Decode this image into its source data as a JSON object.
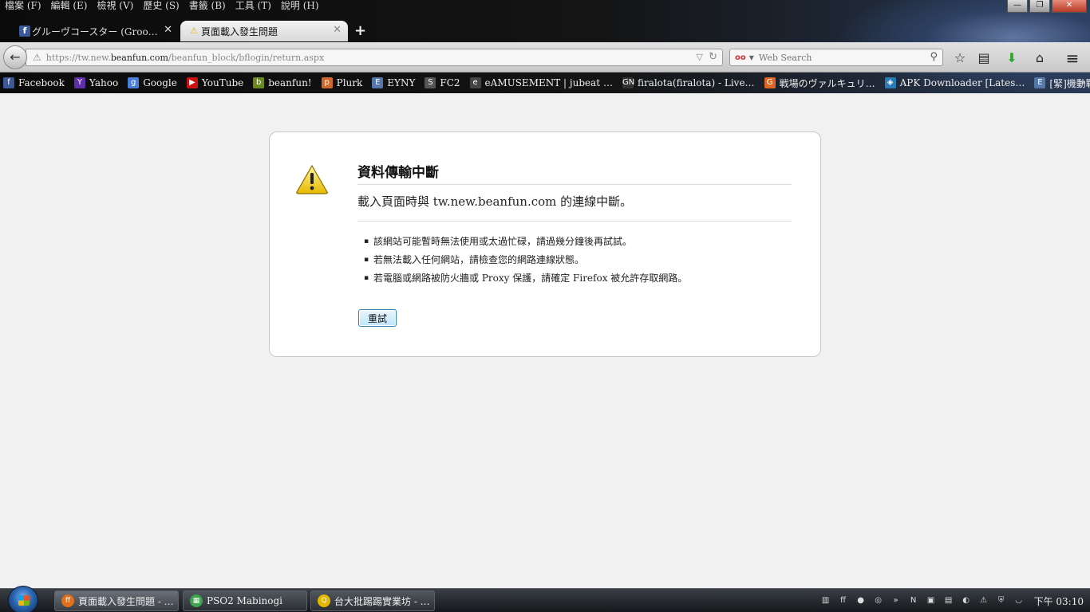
{
  "menu": [
    "檔案 (F)",
    "編輯 (E)",
    "檢視 (V)",
    "歷史 (S)",
    "書籤 (B)",
    "工具 (T)",
    "說明 (H)"
  ],
  "window_buttons": {
    "minimize": "—",
    "restore": "❐",
    "close": "✕"
  },
  "tabs": [
    {
      "label": "グルーヴコースター (Groo…",
      "icon": "f",
      "state": "inactive"
    },
    {
      "label": "頁面載入發生問題",
      "icon": "⚠",
      "state": "active"
    }
  ],
  "new_tab_label": "+",
  "navbar": {
    "back_glyph": "←",
    "url_prefix": "https://tw.new.",
    "url_domain": "beanfun.com",
    "url_path": "/beanfun_block/bflogin/return.aspx",
    "search_placeholder": "Web Search",
    "search_engine_label": "oo"
  },
  "toolbar_icons": {
    "star": "☆",
    "reading_list": "▤",
    "download": "⬇",
    "home": "⌂",
    "menu": "≡"
  },
  "bookmarks": [
    {
      "label": "Facebook",
      "icon": "f",
      "color": "#3b5998"
    },
    {
      "label": "Yahoo",
      "icon": "Y",
      "color": "#5f2ea8"
    },
    {
      "label": "Google",
      "icon": "g",
      "color": "#4a7fd8"
    },
    {
      "label": "YouTube",
      "icon": "▶",
      "color": "#cc1111"
    },
    {
      "label": "beanfun!",
      "icon": "b",
      "color": "#6a8a1e"
    },
    {
      "label": "Plurk",
      "icon": "p",
      "color": "#cf682f"
    },
    {
      "label": "EYNY",
      "icon": "E",
      "color": "#5577aa"
    },
    {
      "label": "FC2",
      "icon": "S",
      "color": "#555555"
    },
    {
      "label": "eAMUSEMENT | jubeat …",
      "icon": "e",
      "color": "#444444"
    },
    {
      "label": "firalota(firalota) - Live…",
      "icon": "GN",
      "color": "#333333"
    },
    {
      "label": "戦場のヴァルキュリ…",
      "icon": "G",
      "color": "#dd6622"
    },
    {
      "label": "APK Downloader [Lates…",
      "icon": "◈",
      "color": "#2a7ab8"
    },
    {
      "label": "[緊]機動戰士高達UC…",
      "icon": "E",
      "color": "#5577aa"
    }
  ],
  "bookmarks_more": "»",
  "error": {
    "title": "資料傳輸中斷",
    "short_desc": "載入頁面時與 tw.new.beanfun.com 的連線中斷。",
    "bullets": [
      "該網站可能暫時無法使用或太過忙碌，請過幾分鐘後再試試。",
      "若無法載入任何網站，請檢查您的網路連線狀態。",
      "若電腦或網路被防火牆或 Proxy 保護，請確定 Firefox 被允許存取網路。"
    ],
    "retry_label": "重試"
  },
  "taskbar": {
    "buttons": [
      {
        "label": "頁面載入發生問題 - …",
        "icon": "ff",
        "color": "#e0701a"
      },
      {
        "label": "PSO2 Mabinogi",
        "icon": "▦",
        "color": "#3fa34d"
      },
      {
        "label": "台大批踢踢實業坊 - …",
        "icon": "Q",
        "color": "#e5b800"
      }
    ],
    "tray_icons": [
      "▥",
      "ff",
      "●",
      "◎",
      "»",
      "N",
      "▣",
      "▤",
      "◐",
      "⚠",
      "⛨",
      "◡"
    ],
    "clock": "下午 03:10"
  }
}
